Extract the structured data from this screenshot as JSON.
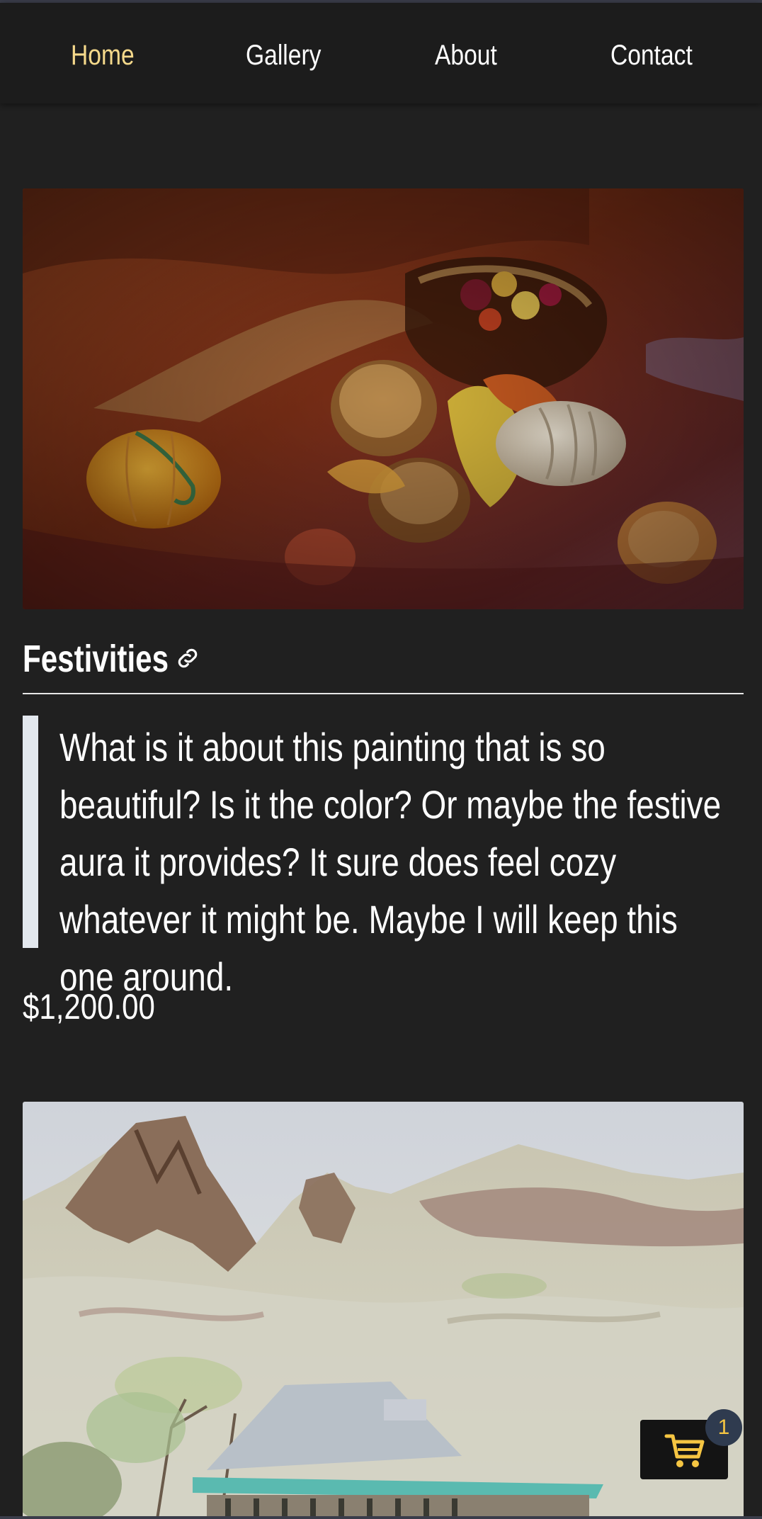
{
  "nav": {
    "items": [
      {
        "label": "Home",
        "active": true
      },
      {
        "label": "Gallery",
        "active": false
      },
      {
        "label": "About",
        "active": false
      },
      {
        "label": "Contact",
        "active": false
      }
    ]
  },
  "artworks": [
    {
      "title": "Festivities",
      "description": "What is it about this painting that is so beautiful? Is it the color? Or maybe the festive aura it provides? It sure does feel cozy whatever it might be. Maybe I will keep this one around.",
      "price": "$1,200.00",
      "image_subject": "autumn still life painting with pumpkins, pinecones and leaves"
    },
    {
      "image_subject": "painting of rocky hills with a house"
    }
  ],
  "cart": {
    "count": "1",
    "icon": "cart-icon"
  },
  "colors": {
    "background": "#202020",
    "navbar": "#1c1c1c",
    "active_link": "#f5d98b",
    "cart_icon": "#f5c542",
    "badge": "#2f3b4f"
  }
}
